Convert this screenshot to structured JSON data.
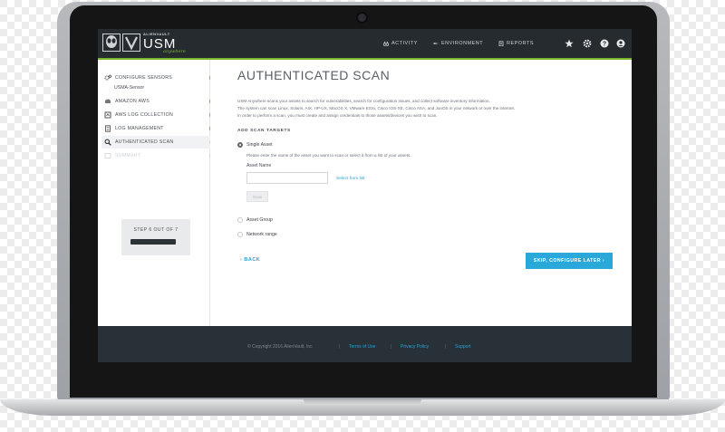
{
  "header": {
    "brand_small": "ALIENVAULT",
    "brand_name": "USM",
    "brand_tag": "anywhere",
    "nav": [
      {
        "label": "ACTIVITY",
        "icon": "binoculars-icon"
      },
      {
        "label": "ENVIRONMENT",
        "icon": "plane-icon"
      },
      {
        "label": "REPORTS",
        "icon": "clipboard-icon"
      }
    ],
    "icons": [
      "star-icon",
      "gear-icon",
      "help-icon",
      "user-icon"
    ]
  },
  "sidebar": {
    "configure_label": "CONFIGURE SENSORS",
    "sensor_label": "USMA-Sensor",
    "items": [
      {
        "label": "AMAZON AWS",
        "icon": "aws-icon",
        "status": "done"
      },
      {
        "label": "AWS LOG COLLECTION",
        "icon": "aws-log-icon",
        "status": "done"
      },
      {
        "label": "LOG MANAGEMENT",
        "icon": "log-icon",
        "status": "done"
      },
      {
        "label": "AUTHENTICATED SCAN",
        "icon": "search-icon",
        "status": "pending"
      },
      {
        "label": "SUMMARY",
        "icon": "summary-icon",
        "status": "pending"
      }
    ],
    "step_text": "STEP 6 OUT OF 7"
  },
  "main": {
    "title": "AUTHENTICATED SCAN",
    "para1": "USM Anywhere scans your assets to search for vulnerabilities, search for configuration issues, and collect software inventory information.",
    "para2": "The system can scan Linux, Solaris, AIX, HP-UX, MacOS X, VMware ESXi, Cisco IOS-XE, Cisco ASA, and JunOS in your network or over the internet.",
    "para3": "In order to perform a scan, you must create and assign credentials to those assets/devices you wish to scan.",
    "targets_heading": "ADD SCAN TARGETS",
    "options": [
      {
        "label": "Single Asset",
        "selected": true
      },
      {
        "label": "Asset Group",
        "selected": false
      },
      {
        "label": "Network range",
        "selected": false
      }
    ],
    "single_help": "Please enter the name of the asset you want to scan or select it from a list of your assets.",
    "asset_name_label": "Asset Name",
    "asset_name_value": "",
    "select_link": "Select from list",
    "mini_button": "Scan",
    "back_label": "BACK",
    "skip_label": "SKIP, CONFIGURE LATER"
  },
  "footer": {
    "copyright": "© Copyright 2016 AlienVault, Inc",
    "links": [
      "Terms of Use",
      "Privacy Policy",
      "Support"
    ]
  },
  "colors": {
    "accent_green": "#7ab72c",
    "accent_blue": "#2aa8d9",
    "nav_bg": "#262b2f"
  }
}
